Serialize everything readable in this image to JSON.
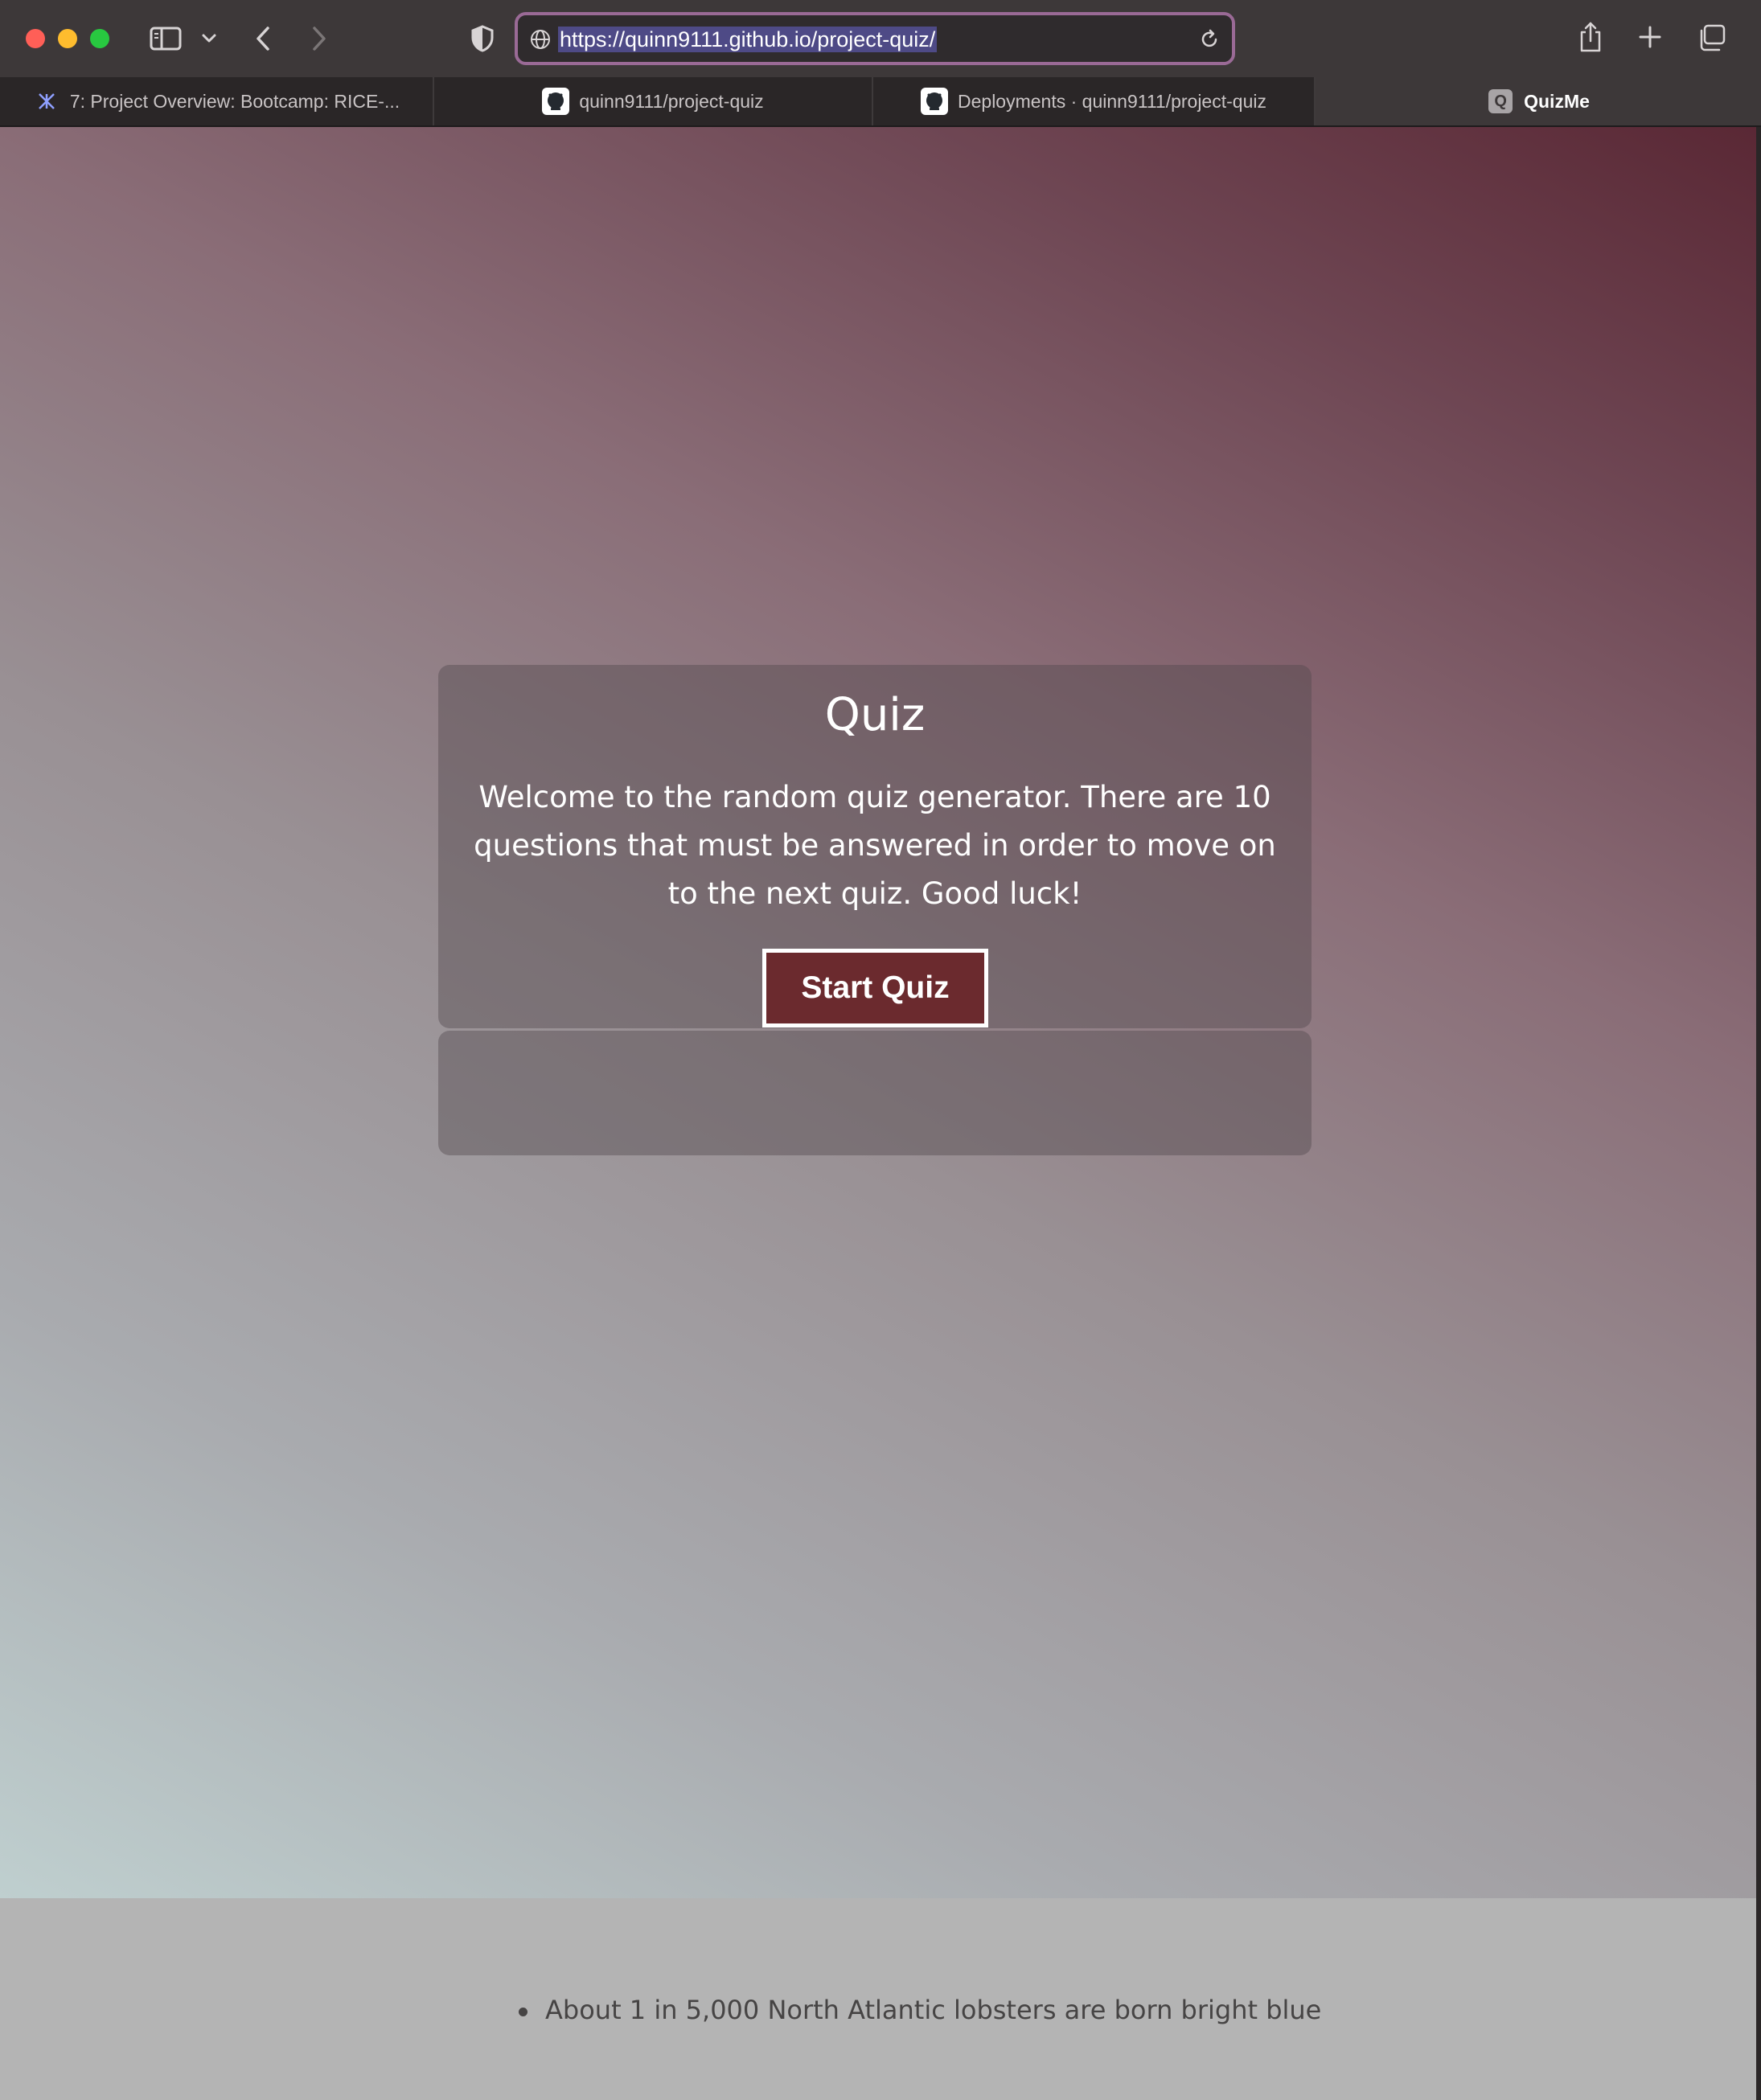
{
  "browser": {
    "url": "https://quinn9111.github.io/project-quiz/",
    "tabs": [
      {
        "label": "7: Project Overview: Bootcamp: RICE-...",
        "icon": "canvas-logo-icon",
        "active": false
      },
      {
        "label": "quinn9111/project-quiz",
        "icon": "github-icon",
        "active": false
      },
      {
        "label": "Deployments · quinn9111/project-quiz",
        "icon": "github-icon",
        "active": false
      },
      {
        "label": "QuizMe",
        "icon": "q-favicon-icon",
        "favicon_letter": "Q",
        "active": true
      }
    ]
  },
  "quiz": {
    "title": "Quiz",
    "description": "Welcome to the random quiz generator. There are 10 questions that must be answered in order to move on to the next quiz. Good luck!",
    "start_label": "Start Quiz"
  },
  "footer": {
    "facts": [
      "About 1 in 5,000 North Atlantic lobsters are born bright blue"
    ]
  },
  "colors": {
    "start_button": "#6b2a2e",
    "url_focus_ring": "#9a6a96",
    "gradient_top_right": "#5a2835",
    "gradient_bottom_left": "#bfcfcf",
    "footer_bg": "#b4b4b4"
  }
}
